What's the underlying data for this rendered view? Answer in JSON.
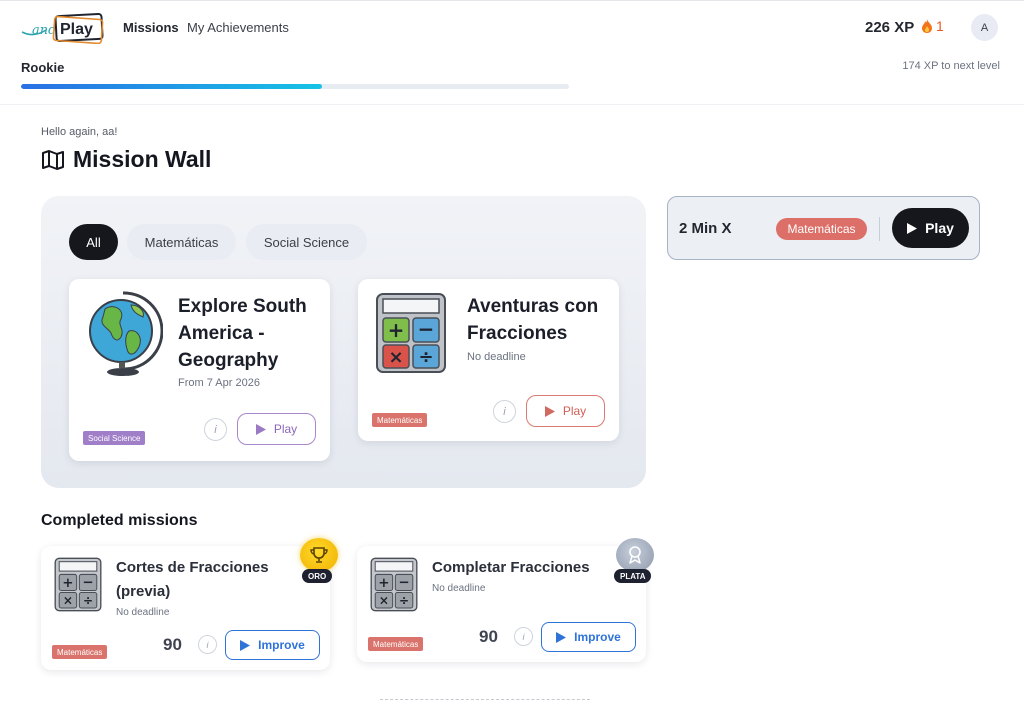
{
  "header": {
    "nav": {
      "missions": "Missions",
      "achievements": "My Achievements"
    },
    "xp": "226 XP",
    "streak": "1",
    "avatar_initial": "A"
  },
  "level": {
    "name": "Rookie",
    "next_level": "174 XP to next level",
    "progress_fraction": 0.55
  },
  "greeting": "Hello again, aa!",
  "page_title": "Mission Wall",
  "filters": {
    "all": "All",
    "matematicas": "Matemáticas",
    "social": "Social Science"
  },
  "missions": [
    {
      "title": "Explore South America - Geography",
      "title_lines": [
        "Explore South",
        "America -",
        "Geography"
      ],
      "subtitle": "From 7 Apr 2026",
      "tag": "Social Science",
      "play": "Play"
    },
    {
      "title": "Aventuras con Fracciones",
      "title_lines": [
        "Aventuras con",
        "Fracciones"
      ],
      "subtitle": "No deadline",
      "tag": "Matemáticas",
      "play": "Play"
    }
  ],
  "quick": {
    "title": "2 Min X",
    "tag": "Matemáticas",
    "play": "Play"
  },
  "completed": {
    "title": "Completed missions",
    "items": [
      {
        "title_lines": [
          "Cortes de Fracciones",
          "(previa)"
        ],
        "subtitle": "No deadline",
        "tag": "Matemáticas",
        "score": "90",
        "improve": "Improve",
        "medal": "ORO"
      },
      {
        "title_lines": [
          "Completar Fracciones"
        ],
        "subtitle": "No deadline",
        "tag": "Matemáticas",
        "score": "90",
        "improve": "Improve",
        "medal": "PLATA"
      }
    ]
  },
  "colors": {
    "accent": "#2f73d8",
    "matematicas": "#d9736b",
    "social": "#a07ec8",
    "progress_start": "#2a6fe5",
    "progress_end": "#16c3e5"
  },
  "icons": {
    "logo": "andplay-logo",
    "streak": "flame-icon",
    "map": "map-icon",
    "play": "play-icon",
    "info": "info-icon",
    "trophy": "trophy-icon",
    "ribbon": "ribbon-icon"
  }
}
